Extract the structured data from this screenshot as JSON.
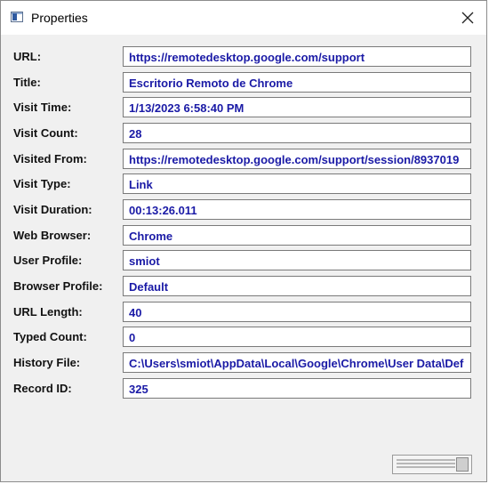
{
  "window": {
    "title": "Properties",
    "close_icon": "close-icon"
  },
  "fields": [
    {
      "label": "URL:",
      "value": "https://remotedesktop.google.com/support"
    },
    {
      "label": "Title:",
      "value": "Escritorio Remoto de Chrome"
    },
    {
      "label": "Visit Time:",
      "value": "1/13/2023 6:58:40 PM"
    },
    {
      "label": "Visit Count:",
      "value": "28"
    },
    {
      "label": "Visited From:",
      "value": "https://remotedesktop.google.com/support/session/8937019"
    },
    {
      "label": "Visit Type:",
      "value": "Link"
    },
    {
      "label": "Visit Duration:",
      "value": "00:13:26.011"
    },
    {
      "label": "Web Browser:",
      "value": "Chrome"
    },
    {
      "label": "User Profile:",
      "value": "smiot"
    },
    {
      "label": "Browser Profile:",
      "value": "Default"
    },
    {
      "label": "URL Length:",
      "value": "40"
    },
    {
      "label": "Typed Count:",
      "value": "0"
    },
    {
      "label": "History File:",
      "value": "C:\\Users\\smiot\\AppData\\Local\\Google\\Chrome\\User Data\\Def"
    },
    {
      "label": "Record ID:",
      "value": "325"
    }
  ],
  "colors": {
    "value_text": "#1a1aa6",
    "background": "#f0f0f0"
  }
}
